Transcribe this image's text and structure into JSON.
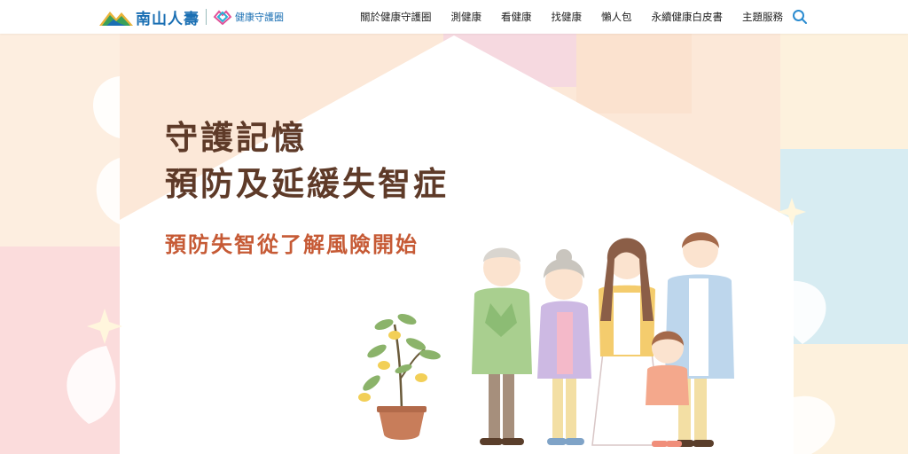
{
  "brand": {
    "name": "南山人壽",
    "sub_name": "健康守護圈"
  },
  "nav": {
    "items": [
      "關於健康守護圈",
      "測健康",
      "看健康",
      "找健康",
      "懶人包",
      "永續健康白皮書",
      "主題服務"
    ]
  },
  "hero": {
    "title_line1": "守護記憶",
    "title_line2": "預防及延緩失智症",
    "subtitle": "預防失智從了解風險開始"
  },
  "colors": {
    "brand_blue": "#1a6fb3",
    "title_brown": "#5e3a28",
    "subtitle_orange": "#c65a35"
  },
  "icons": [
    "mountain-logo-icon",
    "diamond-logo-icon",
    "search-icon",
    "plant-icon",
    "sparkle-icon"
  ]
}
